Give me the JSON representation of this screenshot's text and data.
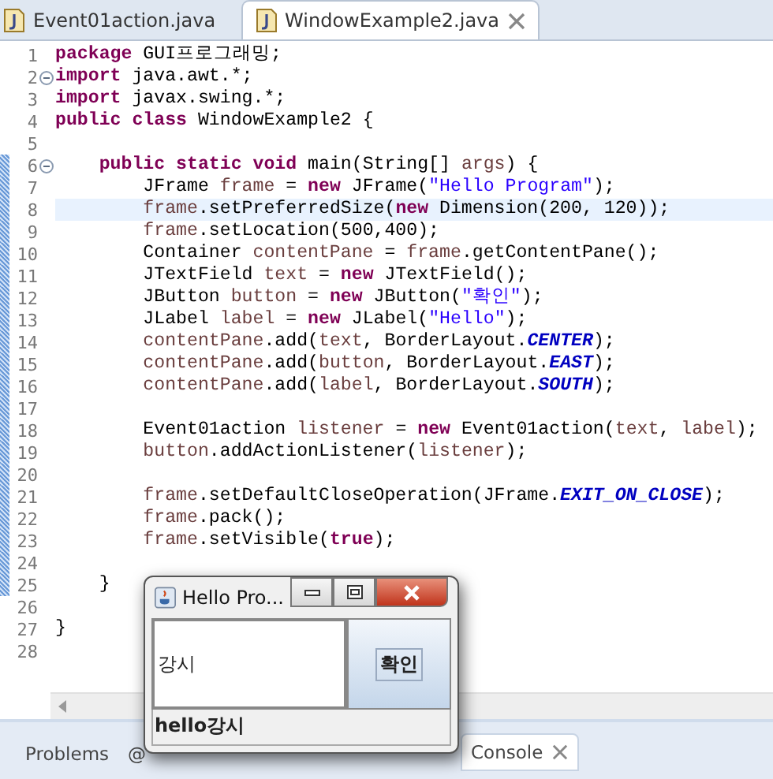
{
  "tabs": [
    {
      "label": "Event01action.java",
      "selected": false,
      "closable": false
    },
    {
      "label": "WindowExample2.java",
      "selected": true,
      "closable": true
    }
  ],
  "editor": {
    "lines": [
      {
        "number": "1",
        "foldable": false,
        "changed": false,
        "current": false,
        "tokens": [
          {
            "kind": "keyword",
            "text": "package "
          },
          {
            "kind": "plain",
            "text": "GUI프로그래밍;"
          }
        ]
      },
      {
        "number": "2",
        "foldable": true,
        "changed": false,
        "current": false,
        "tokens": [
          {
            "kind": "keyword",
            "text": "import "
          },
          {
            "kind": "plain",
            "text": "java.awt.*;"
          }
        ]
      },
      {
        "number": "3",
        "foldable": false,
        "changed": false,
        "current": false,
        "tokens": [
          {
            "kind": "keyword",
            "text": "import "
          },
          {
            "kind": "plain",
            "text": "javax.swing.*;"
          }
        ]
      },
      {
        "number": "4",
        "foldable": false,
        "changed": false,
        "current": false,
        "tokens": [
          {
            "kind": "keyword",
            "text": "public class "
          },
          {
            "kind": "plain",
            "text": "WindowExample2 {"
          }
        ]
      },
      {
        "number": "5",
        "foldable": false,
        "changed": false,
        "current": false
      },
      {
        "number": "6",
        "foldable": true,
        "changed": true,
        "current": false,
        "tokens": [
          {
            "kind": "keyword",
            "text": "    public static void "
          },
          {
            "kind": "plain",
            "text": "main(String[] "
          },
          {
            "kind": "variable",
            "text": "args"
          },
          {
            "kind": "plain",
            "text": ") {"
          }
        ]
      },
      {
        "number": "7",
        "foldable": false,
        "changed": true,
        "current": false,
        "tokens": [
          {
            "kind": "plain",
            "text": "        JFrame "
          },
          {
            "kind": "variable",
            "text": "frame"
          },
          {
            "kind": "plain",
            "text": " = "
          },
          {
            "kind": "keyword",
            "text": "new"
          },
          {
            "kind": "plain",
            "text": " JFrame("
          },
          {
            "kind": "string",
            "text": "\"Hello Program\""
          },
          {
            "kind": "plain",
            "text": ");"
          }
        ]
      },
      {
        "number": "8",
        "foldable": false,
        "changed": true,
        "current": true,
        "tokens": [
          {
            "kind": "variable",
            "text": "        frame"
          },
          {
            "kind": "plain",
            "text": ".setPreferredSize("
          },
          {
            "kind": "keyword",
            "text": "new"
          },
          {
            "kind": "plain",
            "text": " Dimension(200, 120));"
          }
        ]
      },
      {
        "number": "9",
        "foldable": false,
        "changed": true,
        "current": false,
        "tokens": [
          {
            "kind": "variable",
            "text": "        frame"
          },
          {
            "kind": "plain",
            "text": ".setLocation(500,400);"
          }
        ]
      },
      {
        "number": "10",
        "foldable": false,
        "changed": true,
        "current": false,
        "tokens": [
          {
            "kind": "plain",
            "text": "        Container "
          },
          {
            "kind": "variable",
            "text": "contentPane"
          },
          {
            "kind": "plain",
            "text": " = "
          },
          {
            "kind": "variable",
            "text": "frame"
          },
          {
            "kind": "plain",
            "text": ".getContentPane();"
          }
        ]
      },
      {
        "number": "11",
        "foldable": false,
        "changed": true,
        "current": false,
        "tokens": [
          {
            "kind": "plain",
            "text": "        JTextField "
          },
          {
            "kind": "variable",
            "text": "text"
          },
          {
            "kind": "plain",
            "text": " = "
          },
          {
            "kind": "keyword",
            "text": "new"
          },
          {
            "kind": "plain",
            "text": " JTextField();"
          }
        ]
      },
      {
        "number": "12",
        "foldable": false,
        "changed": true,
        "current": false,
        "tokens": [
          {
            "kind": "plain",
            "text": "        JButton "
          },
          {
            "kind": "variable",
            "text": "button"
          },
          {
            "kind": "plain",
            "text": " = "
          },
          {
            "kind": "keyword",
            "text": "new"
          },
          {
            "kind": "plain",
            "text": " JButton("
          },
          {
            "kind": "string",
            "text": "\"확인\""
          },
          {
            "kind": "plain",
            "text": ");"
          }
        ]
      },
      {
        "number": "13",
        "foldable": false,
        "changed": true,
        "current": false,
        "tokens": [
          {
            "kind": "plain",
            "text": "        JLabel "
          },
          {
            "kind": "variable",
            "text": "label"
          },
          {
            "kind": "plain",
            "text": " = "
          },
          {
            "kind": "keyword",
            "text": "new"
          },
          {
            "kind": "plain",
            "text": " JLabel("
          },
          {
            "kind": "string",
            "text": "\"Hello\""
          },
          {
            "kind": "plain",
            "text": ");"
          }
        ]
      },
      {
        "number": "14",
        "foldable": false,
        "changed": true,
        "current": false,
        "tokens": [
          {
            "kind": "variable",
            "text": "        contentPane"
          },
          {
            "kind": "plain",
            "text": ".add("
          },
          {
            "kind": "variable",
            "text": "text"
          },
          {
            "kind": "plain",
            "text": ", BorderLayout."
          },
          {
            "kind": "constant",
            "text": "CENTER"
          },
          {
            "kind": "plain",
            "text": ");"
          }
        ]
      },
      {
        "number": "15",
        "foldable": false,
        "changed": true,
        "current": false,
        "tokens": [
          {
            "kind": "variable",
            "text": "        contentPane"
          },
          {
            "kind": "plain",
            "text": ".add("
          },
          {
            "kind": "variable",
            "text": "button"
          },
          {
            "kind": "plain",
            "text": ", BorderLayout."
          },
          {
            "kind": "constant",
            "text": "EAST"
          },
          {
            "kind": "plain",
            "text": ");"
          }
        ]
      },
      {
        "number": "16",
        "foldable": false,
        "changed": true,
        "current": false,
        "tokens": [
          {
            "kind": "variable",
            "text": "        contentPane"
          },
          {
            "kind": "plain",
            "text": ".add("
          },
          {
            "kind": "variable",
            "text": "label"
          },
          {
            "kind": "plain",
            "text": ", BorderLayout."
          },
          {
            "kind": "constant",
            "text": "SOUTH"
          },
          {
            "kind": "plain",
            "text": ");"
          }
        ]
      },
      {
        "number": "17",
        "foldable": false,
        "changed": true,
        "current": false
      },
      {
        "number": "18",
        "foldable": false,
        "changed": true,
        "current": false,
        "tokens": [
          {
            "kind": "plain",
            "text": "        Event01action "
          },
          {
            "kind": "variable",
            "text": "listener"
          },
          {
            "kind": "plain",
            "text": " = "
          },
          {
            "kind": "keyword",
            "text": "new"
          },
          {
            "kind": "plain",
            "text": " Event01action("
          },
          {
            "kind": "variable",
            "text": "text"
          },
          {
            "kind": "plain",
            "text": ", "
          },
          {
            "kind": "variable",
            "text": "label"
          },
          {
            "kind": "plain",
            "text": ");"
          }
        ]
      },
      {
        "number": "19",
        "foldable": false,
        "changed": true,
        "current": false,
        "tokens": [
          {
            "kind": "variable",
            "text": "        button"
          },
          {
            "kind": "plain",
            "text": ".addActionListener("
          },
          {
            "kind": "variable",
            "text": "listener"
          },
          {
            "kind": "plain",
            "text": ");"
          }
        ]
      },
      {
        "number": "20",
        "foldable": false,
        "changed": true,
        "current": false
      },
      {
        "number": "21",
        "foldable": false,
        "changed": true,
        "current": false,
        "tokens": [
          {
            "kind": "variable",
            "text": "        frame"
          },
          {
            "kind": "plain",
            "text": ".setDefaultCloseOperation(JFrame."
          },
          {
            "kind": "constant",
            "text": "EXIT_ON_CLOSE"
          },
          {
            "kind": "plain",
            "text": ");"
          }
        ]
      },
      {
        "number": "22",
        "foldable": false,
        "changed": true,
        "current": false,
        "tokens": [
          {
            "kind": "variable",
            "text": "        frame"
          },
          {
            "kind": "plain",
            "text": ".pack();"
          }
        ]
      },
      {
        "number": "23",
        "foldable": false,
        "changed": true,
        "current": false,
        "tokens": [
          {
            "kind": "variable",
            "text": "        frame"
          },
          {
            "kind": "plain",
            "text": ".setVisible("
          },
          {
            "kind": "keyword",
            "text": "true"
          },
          {
            "kind": "plain",
            "text": ");"
          }
        ]
      },
      {
        "number": "24",
        "foldable": false,
        "changed": true,
        "current": false
      },
      {
        "number": "25",
        "foldable": false,
        "changed": true,
        "current": false,
        "tokens": [
          {
            "kind": "plain",
            "text": "    }"
          }
        ]
      },
      {
        "number": "26",
        "foldable": false,
        "changed": false,
        "current": false
      },
      {
        "number": "27",
        "foldable": false,
        "changed": false,
        "current": false,
        "tokens": [
          {
            "kind": "plain",
            "text": "}"
          }
        ]
      },
      {
        "number": "28",
        "foldable": false,
        "changed": false,
        "current": false
      }
    ]
  },
  "bottom_tabs": [
    {
      "label": "Problems",
      "selected": false,
      "closable": false
    },
    {
      "label": "@",
      "selected": false,
      "closable": false
    },
    {
      "label": "Console",
      "selected": true,
      "closable": true
    }
  ],
  "popup": {
    "title": "Hello Pro...",
    "text_field": {
      "value": "강시"
    },
    "button": "확인",
    "label": "hello강시"
  }
}
